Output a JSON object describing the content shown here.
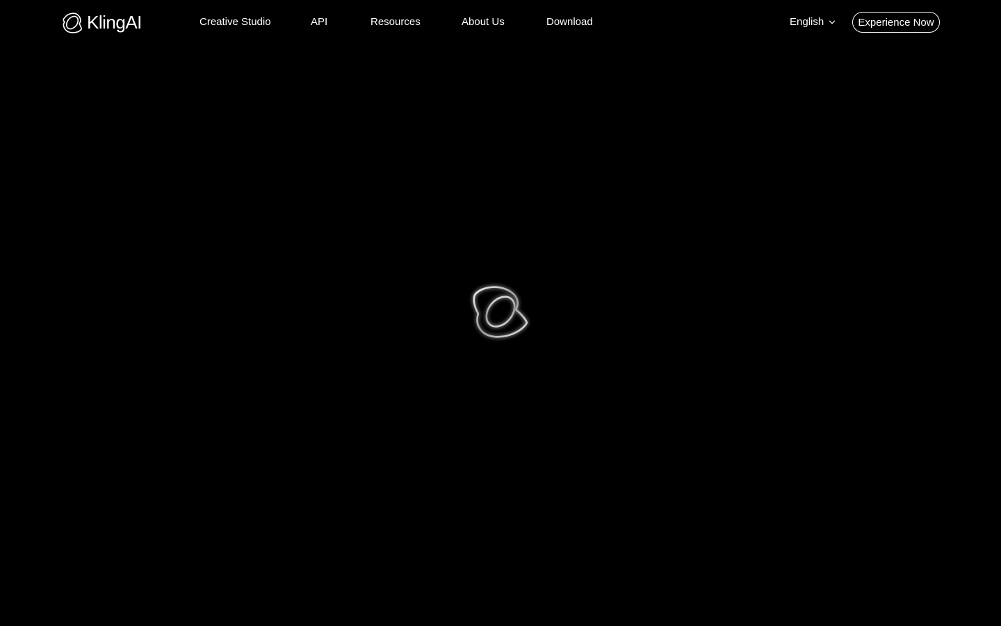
{
  "brand": {
    "name": "KlingAI",
    "logo_icon": "kling-logo-icon"
  },
  "nav": {
    "items": [
      {
        "label": "Creative Studio"
      },
      {
        "label": "API"
      },
      {
        "label": "Resources"
      },
      {
        "label": "About Us"
      },
      {
        "label": "Download"
      }
    ]
  },
  "language": {
    "selected": "English",
    "icon": "chevron-down-icon"
  },
  "cta": {
    "label": "Experience Now"
  },
  "loader": {
    "icon": "kling-logo-icon"
  },
  "colors": {
    "background": "#000000",
    "text": "#ffffff",
    "loader_glow": "#d9d9d9"
  }
}
